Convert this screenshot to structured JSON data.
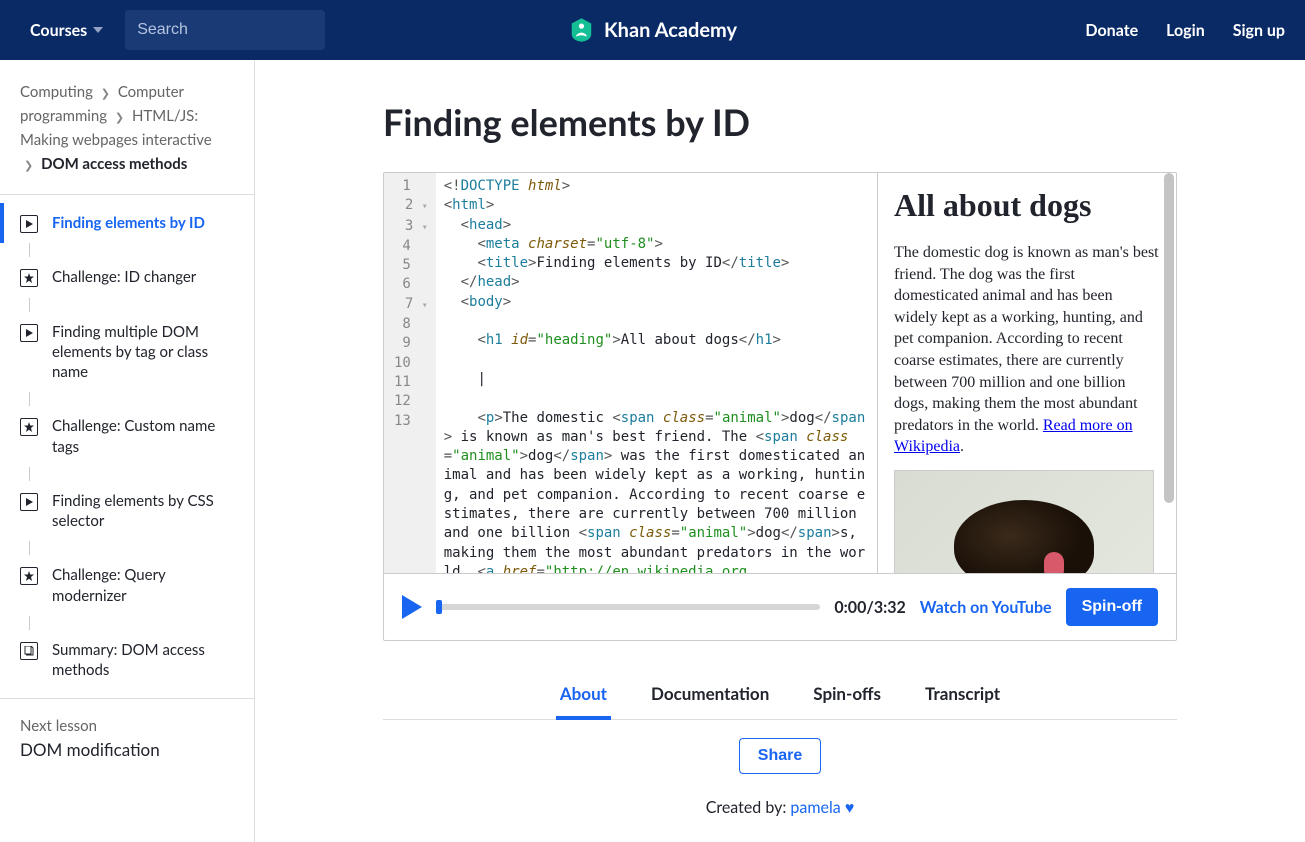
{
  "header": {
    "courses": "Courses",
    "search_placeholder": "Search",
    "brand": "Khan Academy",
    "donate": "Donate",
    "login": "Login",
    "signup": "Sign up"
  },
  "breadcrumb": {
    "items": [
      "Computing",
      "Computer programming",
      "HTML/JS: Making webpages interactive"
    ],
    "current": "DOM access methods"
  },
  "lessons": [
    {
      "type": "video",
      "label": "Finding elements by ID",
      "active": true
    },
    {
      "type": "challenge",
      "label": "Challenge: ID changer"
    },
    {
      "type": "video",
      "label": "Finding multiple DOM elements by tag or class name"
    },
    {
      "type": "challenge",
      "label": "Challenge: Custom name tags"
    },
    {
      "type": "video",
      "label": "Finding elements by CSS selector"
    },
    {
      "type": "challenge",
      "label": "Challenge: Query modernizer"
    },
    {
      "type": "doc",
      "label": "Summary: DOM access methods"
    }
  ],
  "next_lesson": {
    "label": "Next lesson",
    "title": "DOM modification"
  },
  "page": {
    "title": "Finding elements by ID"
  },
  "code": {
    "gutter": [
      "1",
      "2",
      "3",
      "4",
      "5",
      "6",
      "7",
      "8",
      "9",
      "10",
      "11",
      "12",
      "13"
    ],
    "folds": [
      false,
      true,
      true,
      false,
      false,
      false,
      true,
      false,
      false,
      false,
      false,
      false,
      false
    ],
    "title_text": "Finding elements by ID",
    "h1_text": "All about dogs",
    "paragraph_prefix": "The domestic ",
    "animal1": "dog",
    "p_mid1": " is known as man's best friend. The ",
    "animal2": "dog",
    "p_mid2": " was the first domesticated animal and has been widely kept as a working, hunting, and pet companion. According to recent coarse estimates, there are currently between 700 million and one billion ",
    "animal3": "dog",
    "p_mid3": "s, making them the most abundant predators in the world. ",
    "link_href": "http://en.wikipedia.org"
  },
  "preview": {
    "heading": "All about dogs",
    "paragraph": "The domestic dog is known as man's best friend. The dog was the first domesticated animal and has been widely kept as a working, hunting, and pet companion. According to recent coarse estimates, there are currently between 700 million and one billion dogs, making them the most abundant predators in the world. ",
    "link_text": "Read more on Wikipedia"
  },
  "controls": {
    "time": "0:00/3:32",
    "youtube": "Watch on YouTube",
    "spinoff": "Spin-off"
  },
  "tabs": [
    "About",
    "Documentation",
    "Spin-offs",
    "Transcript"
  ],
  "share": "Share",
  "created_by_label": "Created by: ",
  "author": "pamela"
}
